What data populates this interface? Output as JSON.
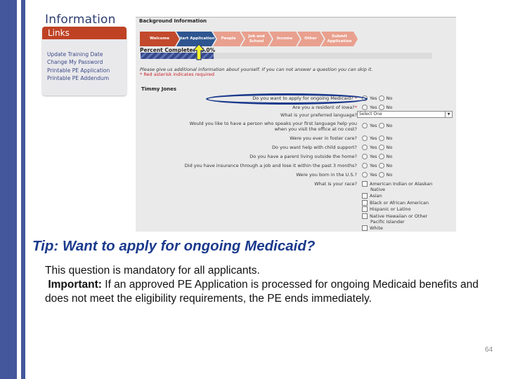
{
  "info_panel": {
    "title": "Information",
    "links_header": "Links",
    "links": [
      "Update Training Date",
      "Change My Password",
      "Printable PE Application",
      "Printable PE Addendum"
    ]
  },
  "app": {
    "section_title": "Background Information",
    "steps": [
      {
        "label": "Welcome",
        "state": "completed",
        "color": "#c2492c"
      },
      {
        "label": "Start Application",
        "state": "current",
        "color": "#2e5590"
      },
      {
        "label": "People",
        "state": "upcoming",
        "color": "#e9a08e"
      },
      {
        "label": "Job and School",
        "state": "upcoming",
        "color": "#e9a08e"
      },
      {
        "label": "Income",
        "state": "upcoming",
        "color": "#e9a08e"
      },
      {
        "label": "Other",
        "state": "upcoming",
        "color": "#e9a08e"
      },
      {
        "label": "Submit Application",
        "state": "upcoming",
        "color": "#e9a08e"
      }
    ],
    "percent_label": "Percent Complete: 25.0%",
    "percent_value": 0.25,
    "intro_text": "Please give us additional information about yourself. If you can not answer a question you can skip it.",
    "required_note": "* Red asterisk indicates required",
    "person_name": "Timmy Jones",
    "questions": [
      {
        "text": "Do you want to apply for ongoing Medicaid?",
        "required": true,
        "type": "yesno",
        "highlighted": true
      },
      {
        "text": "Are you a resident of Iowa?",
        "required": true,
        "type": "yesno"
      },
      {
        "text": "What is your preferred language?",
        "required": false,
        "type": "select",
        "value": "Select One"
      },
      {
        "text": "Would you like to have a person who speaks your first language help you when you visit the office at no cost?",
        "required": false,
        "type": "yesno"
      },
      {
        "text": "Were you ever in foster care?",
        "required": false,
        "type": "yesno"
      },
      {
        "text": "Do you want help with child support?",
        "required": false,
        "type": "yesno"
      },
      {
        "text": "Do you have a parent living outside the home?",
        "required": false,
        "type": "yesno"
      },
      {
        "text": "Did you have insurance through a job and lose it within the past 3 months?",
        "required": false,
        "type": "yesno"
      },
      {
        "text": "Were you born in the U.S.?",
        "required": false,
        "type": "yesno"
      },
      {
        "text": "What is your race?",
        "required": false,
        "type": "checkbox"
      }
    ],
    "yes_label": "Yes",
    "no_label": "No",
    "question_lines": {
      "q4_line1": "Would you like to have a person who speaks your first language help you",
      "q4_line2": "when you visit the office at no cost?"
    },
    "race_options": [
      "American Indian or Alaskan Native",
      "Asian",
      "Black or African American",
      "Hispanic or Latino",
      "Native Hawaiian or Other Pacific Islander",
      "White"
    ],
    "race_lines": [
      "American Indian or Alaskan",
      "Native",
      "Asian",
      "Black or African American",
      "Hispanic or Latino",
      "Native Hawaiian or Other",
      "Pacific Islander",
      "White"
    ],
    "required_star": "*"
  },
  "tip": {
    "title": "Tip: Want to apply for ongoing Medicaid?",
    "line1": "This question is mandatory for all applicants.",
    "important_label": "Important:",
    "important_text": " If an approved PE Application is processed for ongoing Medicaid benefits and does not meet the eligibility requirements, the PE ends immediately."
  },
  "page_number": "64",
  "colors": {
    "band": "#44579c",
    "tip_title": "#1b3a8c",
    "links_header": "#bf4225",
    "required": "#c8202a"
  }
}
